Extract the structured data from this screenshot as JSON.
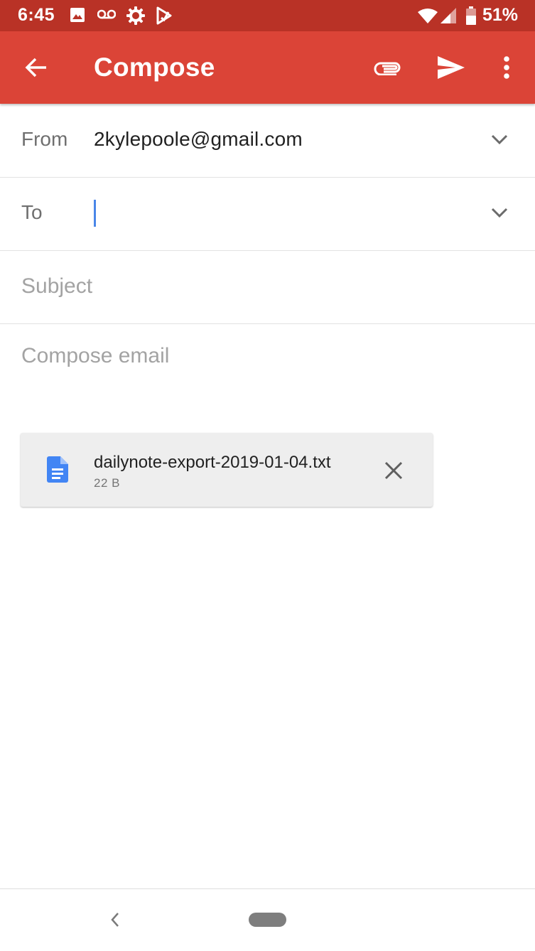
{
  "status_bar": {
    "time": "6:45",
    "battery": "51%",
    "icons": [
      "image-icon",
      "voicemail-icon",
      "settings-icon",
      "play-store-icon",
      "wifi-icon",
      "signal-icon",
      "battery-icon"
    ]
  },
  "app_bar": {
    "title": "Compose",
    "actions": [
      "back-icon",
      "attach-icon",
      "send-icon",
      "more-vert-icon"
    ]
  },
  "from": {
    "label": "From",
    "value": "2kylepoole@gmail.com"
  },
  "to": {
    "label": "To",
    "value": ""
  },
  "subject": {
    "placeholder": "Subject"
  },
  "body": {
    "placeholder": "Compose email"
  },
  "attachment": {
    "file_name": "dailynote-export-2019-01-04.txt",
    "file_size": "22 B",
    "icon": "document-icon"
  },
  "colors": {
    "status_bar": "#b93226",
    "app_bar": "#db4437",
    "caret": "#4a86e8",
    "doc_icon": "#4285f4"
  }
}
